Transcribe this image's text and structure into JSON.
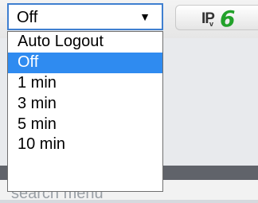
{
  "select": {
    "value": "Off",
    "arrow_icon": "▼"
  },
  "dropdown": {
    "options": [
      "Auto Logout",
      "Off",
      "1 min",
      "3 min",
      "5 min",
      "10 min"
    ],
    "selected_index": 1
  },
  "ipv6_badge": {
    "prefix": "IP",
    "sub": "v",
    "number": "6",
    "number_color": "#22a12a"
  },
  "background": {
    "search_menu_text": "search menu"
  },
  "colors": {
    "highlight": "#2f8bf0",
    "select_border": "#3f7fd0"
  }
}
